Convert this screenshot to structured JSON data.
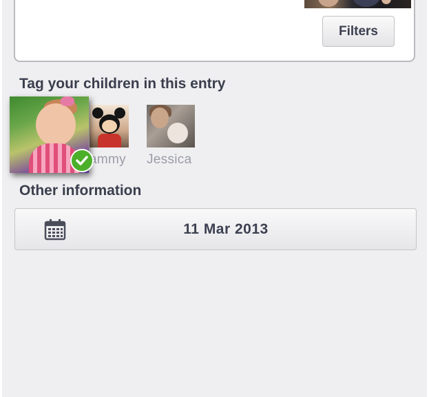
{
  "photo_section": {
    "filters_label": "Filters"
  },
  "tag_section": {
    "heading": "Tag your children in this entry",
    "children": [
      {
        "name": "",
        "selected": true
      },
      {
        "name": "ammy",
        "selected": false
      },
      {
        "name": "Jessica",
        "selected": false
      }
    ]
  },
  "other_section": {
    "heading": "Other information",
    "date": "11 Mar 2013",
    "date_icon": "calendar-icon"
  },
  "colors": {
    "background": "#efeff1",
    "check": "#4caf2a",
    "text": "#3a3e4d",
    "muted_name": "#9a9ca6"
  }
}
